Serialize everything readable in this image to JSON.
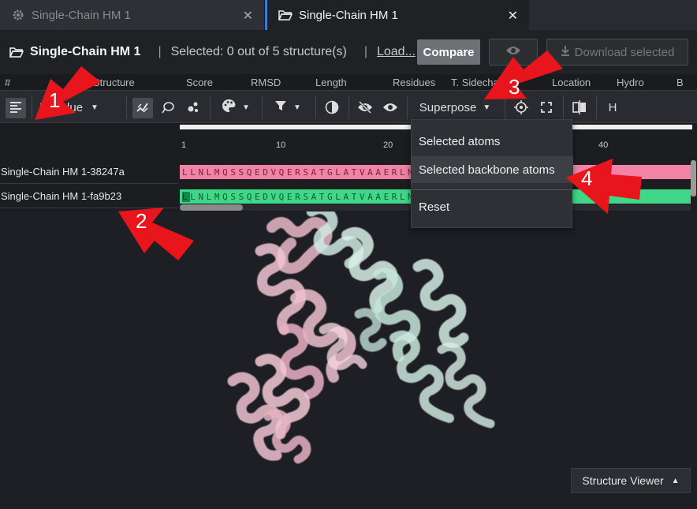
{
  "tabs": [
    {
      "label": "Single-Chain HM 1",
      "icon": "gear-icon",
      "active": false
    },
    {
      "label": "Single-Chain HM 1",
      "icon": "folder-open-icon",
      "active": true
    }
  ],
  "header": {
    "title": "Single-Chain HM 1",
    "separator": "|",
    "selection": "Selected: 0 out of 5 structure(s)",
    "separator2": "|",
    "load": "Load...",
    "compare": "Compare",
    "download": "Download selected"
  },
  "column_strip": [
    "#",
    "Structure",
    "Score",
    "RMSD",
    "Length",
    "Residues",
    "T. Sidechains",
    "Location",
    "Hydro",
    "B"
  ],
  "toolbar": {
    "residue_select": "Residue",
    "superpose": "Superpose",
    "h_label": "H"
  },
  "sequence": {
    "ruler": [
      "1",
      "10",
      "20",
      "40"
    ],
    "rows": [
      {
        "label": "Single-Chain HM 1-38247a",
        "seq": "LLNLMQSSQEDVQERSATGLATVAAERLMRLCAEAVMKDGGIF",
        "color": "pink"
      },
      {
        "label": "Single-Chain HM 1-fa9b23",
        "seq": "LLNLMQSSQEDVQERSATGLATVAAERLMRLCAEAVMRDGGIF",
        "color": "green"
      }
    ]
  },
  "dropdown": {
    "items": [
      "Selected atoms",
      "Selected backbone atoms",
      "Reset"
    ]
  },
  "viewer": {
    "toggle": "Structure Viewer"
  },
  "annotations": [
    "1",
    "2",
    "3",
    "4"
  ],
  "colors": {
    "accent": "#3a7bd5",
    "pink_chain": "#f282a6",
    "green_chain": "#3ed888",
    "arrow": "#e8161c"
  }
}
